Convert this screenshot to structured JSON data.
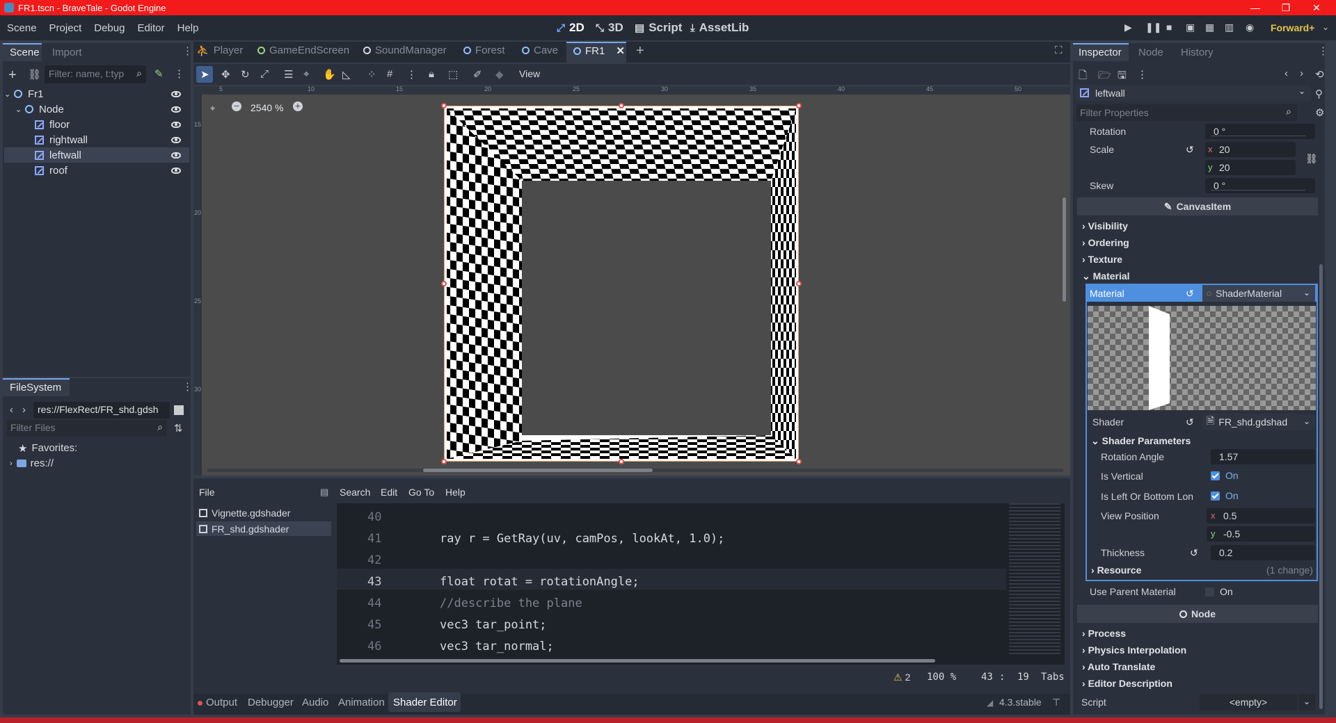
{
  "window": {
    "title": "FR1.tscn - BraveTale - Godot Engine"
  },
  "menu": [
    "Scene",
    "Project",
    "Debug",
    "Editor",
    "Help"
  ],
  "workspaces": [
    {
      "label": "2D",
      "icon": "2d-icon"
    },
    {
      "label": "3D",
      "icon": "3d-icon"
    },
    {
      "label": "Script",
      "icon": "script-icon"
    },
    {
      "label": "AssetLib",
      "icon": "assetlib-icon"
    }
  ],
  "renderer": "Forward+",
  "scene_dock": {
    "tabs": [
      "Scene",
      "Import"
    ],
    "filter_placeholder": "Filter: name, t:typ",
    "tree": [
      {
        "label": "Fr1",
        "icon": "node-icon"
      },
      {
        "label": "Node",
        "icon": "node-icon"
      },
      {
        "label": "floor",
        "icon": "sprite-icon"
      },
      {
        "label": "rightwall",
        "icon": "sprite-icon"
      },
      {
        "label": "leftwall",
        "icon": "sprite-icon"
      },
      {
        "label": "roof",
        "icon": "sprite-icon"
      }
    ]
  },
  "filesystem": {
    "title": "FileSystem",
    "path": "res://FlexRect/FR_shd.gdsh",
    "filter_placeholder": "Filter Files",
    "favorites": "Favorites:",
    "root": "res://"
  },
  "scene_tabs": [
    "Player",
    "GameEndScreen",
    "SoundManager",
    "Forest",
    "Cave",
    "FR1"
  ],
  "viewport": {
    "view_menu": "View",
    "zoom": "2540 %",
    "ruler_top": [
      "5",
      "10",
      "15",
      "20",
      "25",
      "30",
      "35",
      "40",
      "45",
      "50"
    ],
    "ruler_left": [
      "15",
      "20",
      "25",
      "30"
    ]
  },
  "shader_editor": {
    "menus": [
      "File",
      "Search",
      "Edit",
      "Go To",
      "Help"
    ],
    "files": [
      "Vignette.gdshader",
      "FR_shd.gdshader"
    ],
    "lines": [
      {
        "n": "40",
        "text": ""
      },
      {
        "n": "41",
        "text": "ray r = GetRay(uv, camPos, lookAt, 1.0);"
      },
      {
        "n": "42",
        "text": ""
      },
      {
        "n": "43",
        "text": "float rotat = rotationAngle;"
      },
      {
        "n": "44",
        "text": "//describe the plane"
      },
      {
        "n": "45",
        "text": "vec3 tar_point;"
      },
      {
        "n": "46",
        "text": "vec3 tar_normal;"
      }
    ],
    "status": {
      "warnings": "2",
      "zoom": "100 %",
      "line": "43",
      "col": "19",
      "indent": "Tabs"
    }
  },
  "bottom_tabs": [
    "Output",
    "Debugger",
    "Audio",
    "Animation",
    "Shader Editor"
  ],
  "version": "4.3.stable",
  "inspector": {
    "tabs": [
      "Inspector",
      "Node",
      "History"
    ],
    "object": "leftwall",
    "filter_placeholder": "Filter Properties",
    "rotation": {
      "label": "Rotation",
      "value": "0 °"
    },
    "scale": {
      "label": "Scale",
      "x": "20",
      "y": "20"
    },
    "skew": {
      "label": "Skew",
      "value": "0 °"
    },
    "canvasitem": "CanvasItem",
    "sections": [
      "Visibility",
      "Ordering",
      "Texture",
      "Material"
    ],
    "material": {
      "label": "Material",
      "value": "ShaderMaterial"
    },
    "shader": {
      "label": "Shader",
      "value": "FR_shd.gdshad"
    },
    "shader_params_title": "Shader Parameters",
    "params": {
      "rotation_angle": {
        "label": "Rotation Angle",
        "value": "1.57"
      },
      "is_vertical": {
        "label": "Is Vertical",
        "value": "On"
      },
      "is_left": {
        "label": "Is Left Or Bottom Lon",
        "value": "On"
      },
      "view_position": {
        "label": "View Position",
        "x": "0.5",
        "y": "-0.5"
      },
      "thickness": {
        "label": "Thickness",
        "value": "0.2"
      }
    },
    "resource": {
      "label": "Resource",
      "change": "(1 change)"
    },
    "use_parent": {
      "label": "Use Parent Material",
      "value": "On"
    },
    "node_header": "Node",
    "node_sections": [
      "Process",
      "Physics Interpolation",
      "Auto Translate",
      "Editor Description"
    ],
    "script": {
      "label": "Script",
      "value": "<empty>"
    }
  }
}
